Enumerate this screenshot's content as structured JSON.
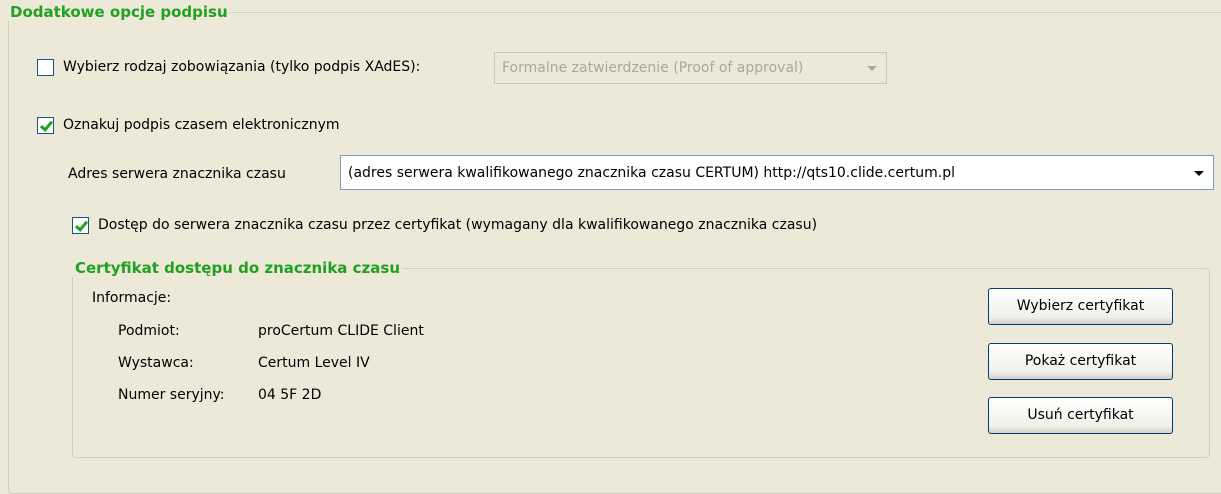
{
  "signature_options": {
    "group_title": "Dodatkowe opcje podpisu",
    "commitment": {
      "checkbox_label": "Wybierz rodzaj zobowiązania (tylko podpis XAdES):",
      "checked": false,
      "select_value": "Formalne zatwierdzenie (Proof of approval)",
      "enabled": false
    },
    "timestamp": {
      "checkbox_label": "Oznakuj podpis czasem elektronicznym",
      "checked": true,
      "server_label": "Adres serwera znacznika czasu",
      "server_value": "(adres serwera kwalifikowanego znacznika czasu CERTUM) http://qts10.clide.certum.pl",
      "cert_access_label": "Dostęp do serwera znacznika czasu przez certyfikat (wymagany dla kwalifikowanego znacznika czasu)",
      "cert_access_checked": true
    },
    "certificate": {
      "group_title": "Certyfikat dostępu do znacznika czasu",
      "info_label": "Informacje:",
      "subject_label": "Podmiot:",
      "subject_value": "proCertum CLIDE Client",
      "issuer_label": "Wystawca:",
      "issuer_value": "Certum Level IV",
      "serial_label": "Numer seryjny:",
      "serial_value": "04 5F 2D",
      "buttons": {
        "select": "Wybierz certyfikat",
        "show": "Pokaż certyfikat",
        "remove": "Usuń certyfikat"
      }
    }
  },
  "colors": {
    "group_title": "#21a121",
    "background": "#ece9d8",
    "check_mark": "#21a121"
  }
}
